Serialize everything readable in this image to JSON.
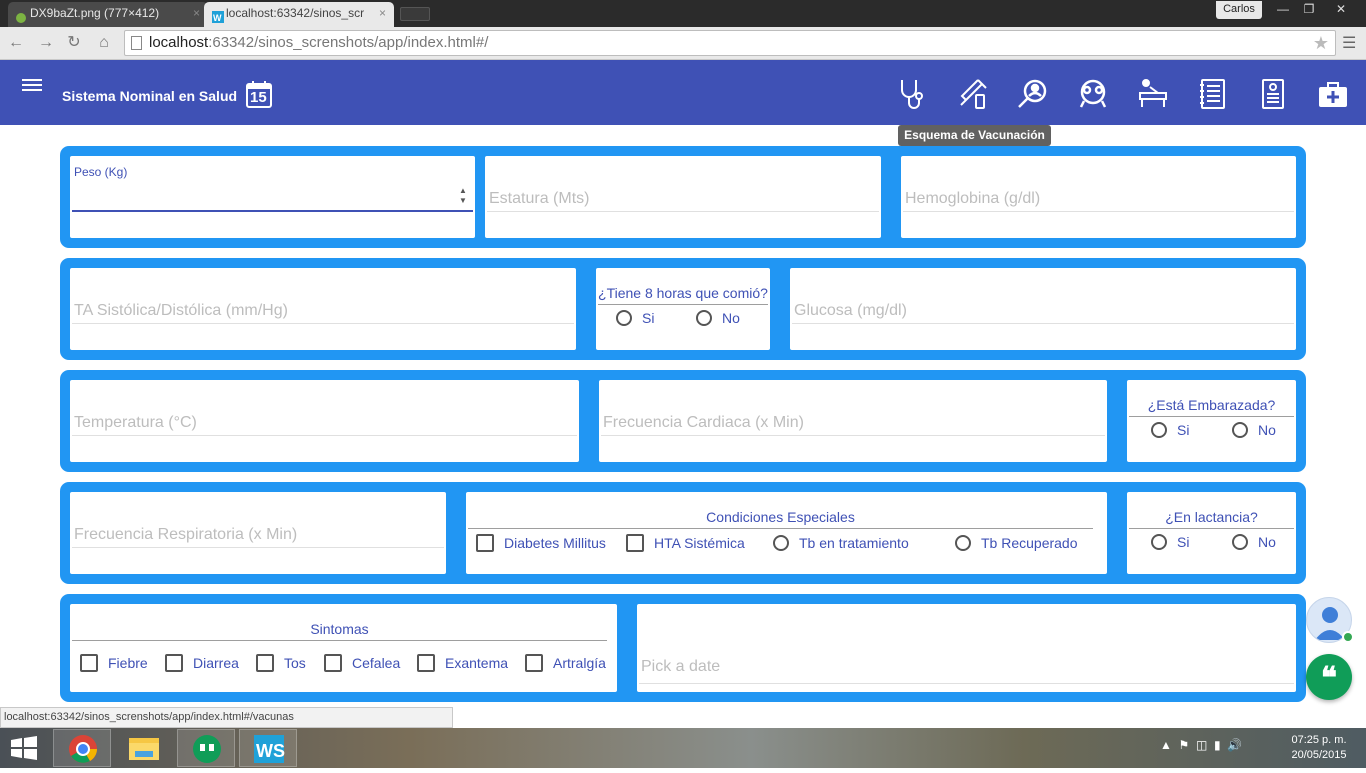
{
  "browser": {
    "tabs": [
      {
        "label": "DX9baZt.png (777×412)",
        "active": false
      },
      {
        "label": "localhost:63342/sinos_scr",
        "active": true
      }
    ],
    "tab_close": "×",
    "profile_name": "Carlos",
    "url_host": "localhost",
    "url_path": ":63342/sinos_screnshots/app/index.html#/",
    "status_url": "localhost:63342/sinos_screnshots/app/index.html#/vacunas"
  },
  "appbar": {
    "title": "Sistema Nominal en Salud",
    "calendar_day": "15",
    "nav_icons": [
      "stethoscope-icon",
      "vaccine-icon",
      "search-health-icon",
      "group-icon",
      "patient-bed-icon",
      "notebook-icon",
      "document-icon",
      "medical-kit-icon"
    ],
    "tooltip": "Esquema de Vacunación"
  },
  "form": {
    "peso_label": "Peso (Kg)",
    "peso_value": "",
    "estatura_placeholder": "Estatura (Mts)",
    "hemoglobina_placeholder": "Hemoglobina (g/dl)",
    "ta_placeholder": "TA Sistólica/Distólica (mm/Hg)",
    "ayuno_question": "¿Tiene 8 horas que comió?",
    "glucosa_placeholder": "Glucosa (mg/dl)",
    "temperatura_placeholder": "Temperatura (°C)",
    "fc_placeholder": "Frecuencia Cardiaca (x Min)",
    "embarazada_question": "¿Está Embarazada?",
    "fr_placeholder": "Frecuencia Respiratoria (x Min)",
    "condiciones_title": "Condiciones Especiales",
    "condiciones": {
      "diabetes": "Diabetes Millitus",
      "hta": "HTA Sistémica",
      "tb_tratamiento": "Tb en tratamiento",
      "tb_recuperado": "Tb Recuperado"
    },
    "lactancia_question": "¿En lactancia?",
    "yes": "Si",
    "no": "No",
    "sintomas_title": "Sintomas",
    "sintomas": [
      "Fiebre",
      "Diarrea",
      "Tos",
      "Cefalea",
      "Exantema",
      "Artralgía"
    ],
    "date_placeholder": "Pick a date"
  },
  "taskbar": {
    "time": "07:25 p. m.",
    "date": "20/05/2015"
  },
  "colors": {
    "primary": "#3f51b5",
    "row_background": "#2196f3",
    "hangouts": "#109d58"
  }
}
